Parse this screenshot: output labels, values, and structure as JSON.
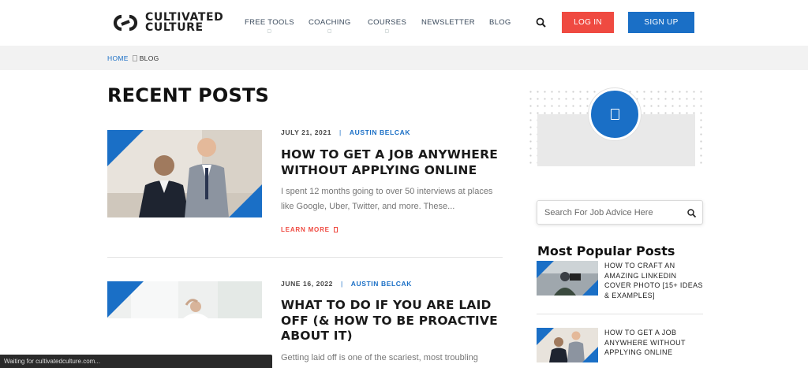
{
  "header": {
    "logo": {
      "line1": "CULTIVATED",
      "line2": "CULTURE",
      "icon": "cultivated-culture-logo-icon"
    },
    "nav": [
      {
        "label": "FREE TOOLS",
        "has_dropdown": true
      },
      {
        "label": "COACHING",
        "has_dropdown": true
      },
      {
        "label": "COURSES",
        "has_dropdown": true
      },
      {
        "label": "NEWSLETTER",
        "has_dropdown": false
      },
      {
        "label": "BLOG",
        "has_dropdown": false
      }
    ],
    "search_icon": "search-icon",
    "login_label": "LOG IN",
    "signup_label": "SIGN UP",
    "colors": {
      "login": "#ef4a41",
      "signup": "#1a6fc6"
    }
  },
  "breadcrumb": {
    "home": "HOME",
    "current": "BLOG"
  },
  "main": {
    "title": "RECENT POSTS",
    "posts": [
      {
        "date": "JULY 21, 2021",
        "author": "AUSTIN BELCAK",
        "title": "HOW TO GET A JOB ANYWHERE WITHOUT APPLYING ONLINE",
        "excerpt": "I spent 12 months going to over 50 interviews at places like Google, Uber, Twitter, and more. These...",
        "read_more": "LEARN MORE"
      },
      {
        "date": "JUNE 16, 2022",
        "author": "AUSTIN BELCAK",
        "title": "WHAT TO DO IF YOU ARE LAID OFF (& HOW TO BE PROACTIVE ABOUT IT)",
        "excerpt": "Getting laid off is one of the scariest, most troubling"
      }
    ]
  },
  "sidebar": {
    "search_placeholder": "Search For Job Advice Here",
    "popular_title": "Most Popular Posts",
    "popular": [
      {
        "title": "HOW TO CRAFT AN AMAZING LINKEDIN COVER PHOTO [15+ IDEAS & EXAMPLES]"
      },
      {
        "title": "HOW TO GET A JOB ANYWHERE WITHOUT APPLYING ONLINE"
      }
    ]
  },
  "status": {
    "text": "Waiting for cultivatedculture.com..."
  },
  "accent": "#1a6fc6"
}
